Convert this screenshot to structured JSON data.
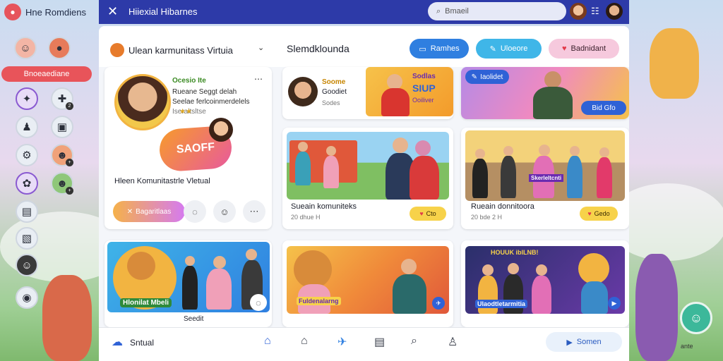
{
  "app": {
    "brand": "Hne Romdiens",
    "window_title": "Hiiexial Hibarnes"
  },
  "search": {
    "value": "Bmaeil"
  },
  "sidebar": {
    "pill_label": "Bnoeaediane",
    "icons": [
      "profile-icon",
      "chat-icon",
      "puzzle-icon",
      "gift-icon",
      "star-icon",
      "game-icon",
      "ninja-icon",
      "screen-icon",
      "bike-icon",
      "friend-icon",
      "settings-icon",
      "buddy-icon",
      "doc-icon",
      "clipboard-icon",
      "avatar-icon",
      "badge-icon"
    ]
  },
  "header": {
    "community": "Ulean karmunitass Virtuia",
    "section": "Slemdklounda",
    "buttons": [
      {
        "label": "Ramhes"
      },
      {
        "label": "Uloeore"
      },
      {
        "label": "Badnidant"
      }
    ]
  },
  "profile_card": {
    "name": "Ocesio Ite",
    "line1": "Rueane Seggt delah",
    "line2": "Seelae ferlcoinmerdelels",
    "line3": "Iseraltsltse",
    "sticker_text": "SAOFF",
    "caption": "Hleen Komunitastrle Vletual",
    "primary_label": "Bagaritlaas"
  },
  "top_card": {
    "title": "Soome",
    "subtitle": "Goodiet",
    "meta": "Sodes",
    "poster_line1": "Sodlas",
    "poster_line2": "SIUP",
    "poster_line3": "Ooiliver"
  },
  "featured_tag": {
    "label": "Iaolidet",
    "chip": "Bid Gfo"
  },
  "cards": [
    {
      "title": "Sueain komuniteks",
      "meta": "20 dhue H",
      "badge": "Cto"
    },
    {
      "title": "Rueain donnitoora",
      "meta": "20 bde 2 H",
      "badge": "Gedo",
      "overlay": "Skerleltcnti"
    },
    {
      "title": "Seedit",
      "overlay": "Hlonilat Mbeli"
    },
    {
      "overlay": "Fuldenalarng"
    },
    {
      "overlay": "Ulaodtletarmitia",
      "banner": "HOUUK iblLNB!"
    }
  ],
  "nav": {
    "label": "Sntual",
    "cta": "Somen"
  },
  "right_panel": {
    "label": "ante"
  },
  "colors": {
    "topbar": "#2d3aa8",
    "accent_blue": "#2f7fe0",
    "accent_pink": "#e8545a",
    "fab": "#3cb89a"
  }
}
